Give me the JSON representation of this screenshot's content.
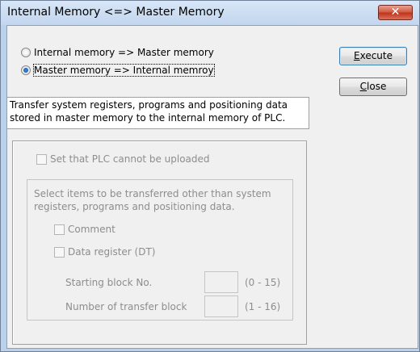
{
  "window": {
    "title": "Internal Memory <=> Master Memory",
    "close_glyph": "✕"
  },
  "options": {
    "opt1_label": "Internal memory => Master memory",
    "opt2_label": "Master memory => Internal memroy",
    "selected": "opt2"
  },
  "buttons": {
    "execute_label_prefix": "",
    "execute_mnemonic": "E",
    "execute_label_rest": "xecute",
    "close_mnemonic": "C",
    "close_label_rest": "lose"
  },
  "description": {
    "line1": "Transfer system registers, programs and positioning data",
    "line2": "stored in master memory to the internal memory of PLC."
  },
  "settings": {
    "no_upload_label": "Set that PLC cannot be uploaded",
    "items_desc_line1": "Select items to be transferred other than system",
    "items_desc_line2": "registers, programs and positioning data.",
    "comment_label": "Comment",
    "data_register_label": "Data register (DT)",
    "start_block_label": "Starting block No.",
    "start_block_range": "(0 - 15)",
    "start_block_value": "",
    "num_blocks_label": "Number of transfer block",
    "num_blocks_range": "(1 - 16)",
    "num_blocks_value": ""
  }
}
